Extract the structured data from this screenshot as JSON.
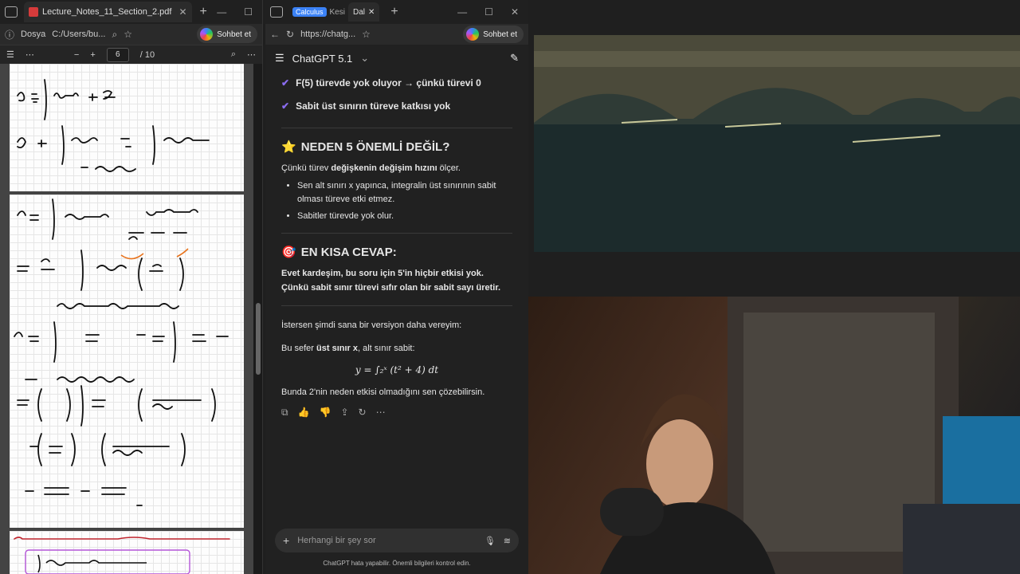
{
  "left_browser": {
    "tab_title": "Lecture_Notes_11_Section_2.pdf",
    "address_label": "Dosya",
    "address_path": "C:/Users/bu...",
    "sohbet": "Sohbet et",
    "pdf": {
      "current_page": "6",
      "total_pages": "/ 10"
    }
  },
  "mid_browser": {
    "tabs": [
      "Calculus",
      "Kesi",
      "Dal"
    ],
    "url": "https://chatg...",
    "sohbet": "Sohbet et",
    "model": "ChatGPT 5.1",
    "checks": [
      "F(5) türevde yok oluyor → çünkü türevi 0",
      "Sabit üst sınırın türeve katkısı yok"
    ],
    "h_why": "NEDEN 5 ÖNEMLİ DEĞİL?",
    "why_intro_pre": "Çünkü türev ",
    "why_intro_bold": "değişkenin değişim hızını",
    "why_intro_post": " ölçer.",
    "bullets": [
      "Sen alt sınırı x yapınca, integralin üst sınırının sabit olması türeve etki etmez.",
      "Sabitler türevde yok olur."
    ],
    "h_short": "EN KISA CEVAP:",
    "short_1": "Evet kardeşim, bu soru için 5'in hiçbir etkisi yok.",
    "short_2": "Çünkü sabit sınır türevi sıfır olan bir sabit sayı üretir.",
    "p1": "İstersen şimdi sana bir versiyon daha vereyim:",
    "p2_pre": "Bu sefer ",
    "p2_bold": "üst sınır x",
    "p2_post": ", alt sınır sabit:",
    "equation": "y = ∫₂ˣ (t² + 4) dt",
    "p3": "Bunda 2'nin neden etkisi olmadığını sen çözebilirsin.",
    "input_placeholder": "Herhangi bir şey sor",
    "footer": "ChatGPT hata yapabilir. Önemli bilgileri kontrol edin."
  },
  "icons": {
    "star": "⭐",
    "target": "🎯",
    "check": "✔"
  }
}
